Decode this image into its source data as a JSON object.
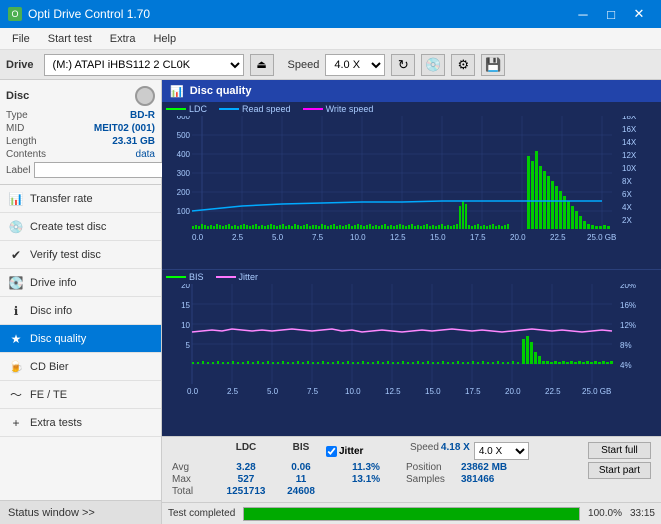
{
  "titleBar": {
    "title": "Opti Drive Control 1.70",
    "minimize": "─",
    "maximize": "□",
    "close": "✕"
  },
  "menuBar": {
    "items": [
      "File",
      "Start test",
      "Extra",
      "Help"
    ]
  },
  "driveBar": {
    "label": "Drive",
    "driveValue": "(M:)  ATAPI iHBS112  2 CL0K",
    "speedLabel": "Speed",
    "speedValue": "4.0 X"
  },
  "disc": {
    "title": "Disc",
    "type": "BD-R",
    "mid": "MEIT02 (001)",
    "length": "23.31 GB",
    "contents": "data",
    "labelKey": "Label"
  },
  "navItems": [
    {
      "id": "transfer-rate",
      "label": "Transfer rate",
      "active": false
    },
    {
      "id": "create-test-disc",
      "label": "Create test disc",
      "active": false
    },
    {
      "id": "verify-test-disc",
      "label": "Verify test disc",
      "active": false
    },
    {
      "id": "drive-info",
      "label": "Drive info",
      "active": false
    },
    {
      "id": "disc-info",
      "label": "Disc info",
      "active": false
    },
    {
      "id": "disc-quality",
      "label": "Disc quality",
      "active": true
    },
    {
      "id": "cd-bier",
      "label": "CD Bier",
      "active": false
    },
    {
      "id": "fe-te",
      "label": "FE / TE",
      "active": false
    },
    {
      "id": "extra-tests",
      "label": "Extra tests",
      "active": false
    }
  ],
  "statusWindow": "Status window >>",
  "discQuality": {
    "title": "Disc quality",
    "legends": {
      "top": [
        "LDC",
        "Read speed",
        "Write speed"
      ],
      "bottom": [
        "BIS",
        "Jitter"
      ]
    }
  },
  "chart1": {
    "yMax": 600,
    "yLabels": [
      "600",
      "500",
      "400",
      "300",
      "200",
      "100",
      "0"
    ],
    "yRight": [
      "18X",
      "16X",
      "14X",
      "12X",
      "10X",
      "8X",
      "6X",
      "4X",
      "2X"
    ],
    "xLabels": [
      "0.0",
      "2.5",
      "5.0",
      "7.5",
      "10.0",
      "12.5",
      "15.0",
      "17.5",
      "20.0",
      "22.5",
      "25.0 GB"
    ]
  },
  "chart2": {
    "yMax": 20,
    "yLabels": [
      "20",
      "15",
      "10",
      "5",
      "0"
    ],
    "yRight": [
      "20%",
      "16%",
      "12%",
      "8%",
      "4%"
    ],
    "xLabels": [
      "0.0",
      "2.5",
      "5.0",
      "7.5",
      "10.0",
      "12.5",
      "15.0",
      "17.5",
      "20.0",
      "22.5",
      "25.0 GB"
    ]
  },
  "stats": {
    "headers": [
      "LDC",
      "BIS",
      "",
      "Jitter",
      "Speed",
      ""
    ],
    "avg": {
      "ldc": "3.28",
      "bis": "0.06",
      "jitter": "11.3%"
    },
    "max": {
      "ldc": "527",
      "bis": "11",
      "jitter": "13.1%"
    },
    "total": {
      "ldc": "1251713",
      "bis": "24608"
    },
    "position": "23862 MB",
    "samples": "381466",
    "speedVal": "4.18 X",
    "speedSelect": "4.0 X",
    "startFull": "Start full",
    "startPart": "Start part"
  },
  "progress": {
    "percent": 100,
    "text": "Test completed",
    "time": "33:15"
  },
  "colors": {
    "ldc": "#00ff00",
    "readSpeed": "#00aaff",
    "writeSpeed": "#ff00ff",
    "bis": "#00ff00",
    "jitter": "#ff77ff",
    "chartBg": "#1a2a5a",
    "gridLine": "#2a3f7a"
  }
}
